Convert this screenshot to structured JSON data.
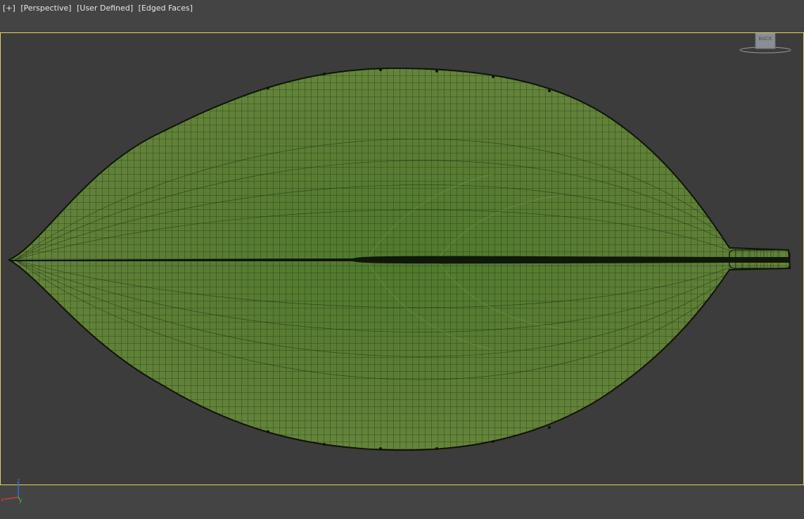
{
  "viewport": {
    "labels": [
      "[+]",
      "[Perspective]",
      "[User Defined]",
      "[Edged Faces]"
    ],
    "border_color": "#e1d35a",
    "background": "#3c3c3c"
  },
  "viewcube": {
    "face_label": "BACK"
  },
  "axis_gizmo": {
    "x_label": "x",
    "y_label": "y",
    "z_label": "z",
    "x_color": "#d33a3a",
    "y_color": "#3fbf3f",
    "z_color": "#3a6ad3"
  },
  "model": {
    "icon": "leaf-mesh",
    "fill_color": "#5a7a32",
    "wire_color": "#1d2a12"
  }
}
